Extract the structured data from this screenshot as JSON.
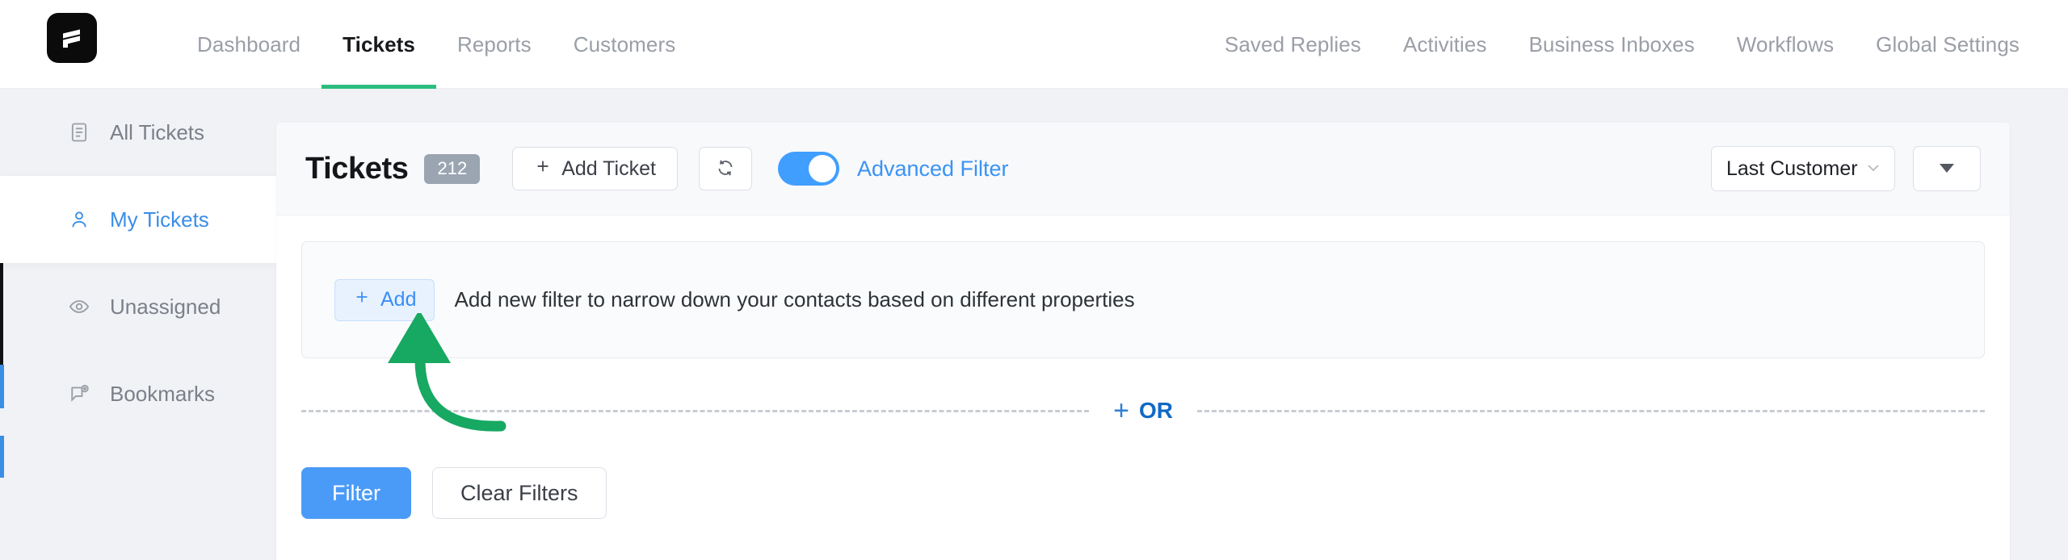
{
  "brand": {
    "logo_icon": "fluent-support-logo",
    "logo_bg": "#0b0b0b"
  },
  "colors": {
    "accent_blue": "#3a93f5",
    "active_tab_underline": "#2bbd7e",
    "badge_gray": "#9aa5b1",
    "annotation_green": "#17a862",
    "or_blue": "#1169c4"
  },
  "topnav": {
    "left_items": [
      {
        "label": "Dashboard",
        "active": false
      },
      {
        "label": "Tickets",
        "active": true
      },
      {
        "label": "Reports",
        "active": false
      },
      {
        "label": "Customers",
        "active": false
      }
    ],
    "right_items": [
      {
        "label": "Saved Replies"
      },
      {
        "label": "Activities"
      },
      {
        "label": "Business Inboxes"
      },
      {
        "label": "Workflows"
      },
      {
        "label": "Global Settings"
      }
    ]
  },
  "sidebar": {
    "items": [
      {
        "label": "All Tickets",
        "icon": "document-list-icon",
        "selected": false
      },
      {
        "label": "My Tickets",
        "icon": "user-icon",
        "selected": true
      },
      {
        "label": "Unassigned",
        "icon": "eye-icon",
        "selected": false
      },
      {
        "label": "Bookmarks",
        "icon": "comment-mention-icon",
        "selected": false
      }
    ]
  },
  "toolbar": {
    "title": "Tickets",
    "count": "212",
    "add_ticket_label": "Add Ticket",
    "refresh_icon": "refresh-icon",
    "advanced_filter_label": "Advanced Filter",
    "advanced_filter_on": true,
    "sort_select_value": "Last Customer Respons",
    "sort_select_icon": "chevron-down-icon",
    "more_button_icon": "caret-down-icon"
  },
  "filter_panel": {
    "add_label": "Add",
    "add_icon": "plus-icon",
    "hint": "Add new filter to narrow down your contacts based on different properties"
  },
  "or_row": {
    "label": "OR",
    "plus": "+"
  },
  "actions": {
    "filter_label": "Filter",
    "clear_label": "Clear Filters"
  },
  "annotation": {
    "type": "curved-arrow",
    "points_to": "Add",
    "color": "#17a862"
  }
}
